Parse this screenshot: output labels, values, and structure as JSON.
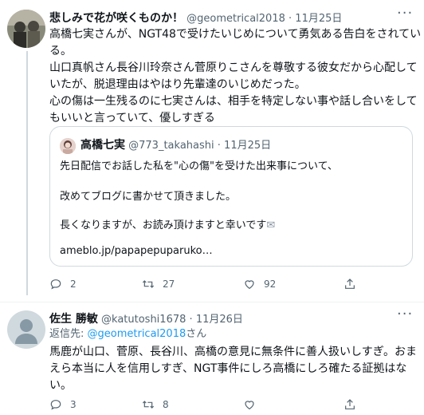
{
  "tweet1": {
    "name": "悲しみで花が咲くものか！",
    "handle": "@geometrical2018",
    "sep": "·",
    "date": "11月25日",
    "body": [
      "高橋七実さんが、NGT48で受けたいじめについて勇気ある告白をされてい",
      "る。",
      "山口真帆さん長谷川玲奈さん菅原りこさんを尊敬する彼女だから心配して",
      "いたが、脱退理由はやはり先輩達のいじめだった。",
      "心の傷は一生残るのに七実さんは、相手を特定しない事や話し合いをして",
      "もいいと言っていて、優しすぎる"
    ],
    "quote": {
      "name": "高橋七実",
      "handle": "@773_takahashi",
      "sep": "·",
      "date": "11月25日",
      "line1": "先日配信でお話した私を\"心の傷\"を受けた出来事について、",
      "line2": "改めてブログに書かせて頂きました。",
      "line3": "長くなりますが、お読み頂けますと幸いです",
      "envelope": "✉",
      "link": "ameblo.jp/papapepuparuko…"
    },
    "actions": {
      "replies": "2",
      "retweets": "27",
      "likes": "92"
    }
  },
  "tweet2": {
    "name": "佐生 勝敏",
    "handle": "@katutoshi1678",
    "sep": "·",
    "date": "11月26日",
    "reply_prefix": "返信先: ",
    "reply_handle": "@geometrical2018",
    "reply_suffix": "さん",
    "body": [
      "馬鹿が山口、菅原、長谷川、高橋の意見に無条件に善人扱いしすぎ。おま",
      "えら本当に人を信用しすぎ、NGT事件にしろ高橋にしろ確たる証拠はな",
      "い。"
    ],
    "actions": {
      "replies": "3",
      "retweets": "8",
      "likes": ""
    }
  },
  "more_label": "···",
  "icons": [
    "more-icon",
    "reply-icon",
    "retweet-icon",
    "like-icon",
    "share-icon",
    "default-avatar-icon"
  ],
  "colors": {
    "link": "#1d9bf0",
    "secondary": "#536471",
    "border": "#cfd9de"
  }
}
